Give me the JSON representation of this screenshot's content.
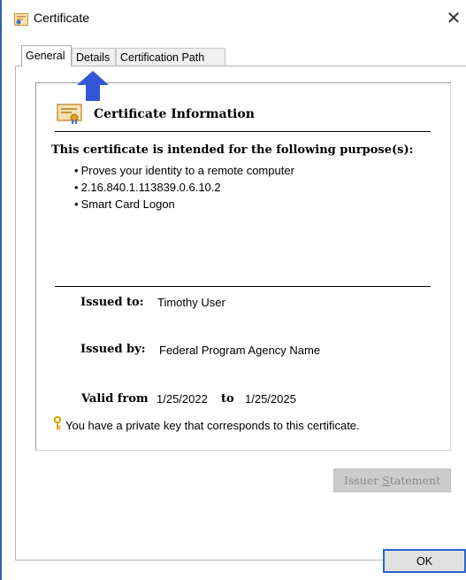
{
  "window": {
    "title": "Certificate",
    "close_glyph": "✕",
    "icon": "certificate-icon"
  },
  "tabs": [
    {
      "label": "General",
      "active": true
    },
    {
      "label": "Details",
      "active": false
    },
    {
      "label": "Certification Path",
      "active": false
    }
  ],
  "annotation": {
    "icon": "arrow-up-icon",
    "color": "#3355d6"
  },
  "info": {
    "title": "Certificate Information",
    "purpose_heading": "This certificate is intended for the following purpose(s):",
    "purposes": [
      "Proves your identity to a remote computer",
      "2.16.840.1.113839.0.6.10.2",
      "Smart Card Logon"
    ],
    "issued_to_label": "Issued to:",
    "issued_to": "Timothy User",
    "issued_by_label": "Issued by:",
    "issued_by": "Federal Program Agency Name",
    "valid_from_label": "Valid from",
    "valid_from": "1/25/2022",
    "valid_to_label": "to",
    "valid_to": "1/25/2025",
    "private_key_note": "You have a private key that corresponds to this certificate."
  },
  "buttons": {
    "issuer_statement_prefix": "Issuer ",
    "issuer_statement_accel": "S",
    "issuer_statement_suffix": "tatement",
    "ok": "OK"
  }
}
